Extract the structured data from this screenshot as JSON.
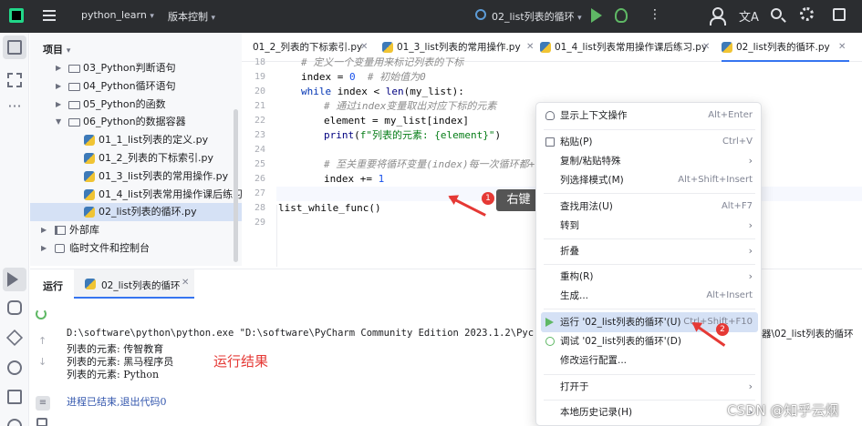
{
  "topbar": {
    "project_name": "python_learn",
    "vcs_label": "版本控制",
    "run_config": "02_list列表的循环"
  },
  "project_panel": {
    "title": "项目",
    "tree": [
      {
        "label": "03_Python判断语句",
        "type": "folder",
        "expanded": false
      },
      {
        "label": "04_Python循环语句",
        "type": "folder",
        "expanded": false
      },
      {
        "label": "05_Python的函数",
        "type": "folder",
        "expanded": false
      },
      {
        "label": "06_Python的数据容器",
        "type": "folder",
        "expanded": true
      },
      {
        "label": "01_1_list列表的定义.py",
        "type": "py"
      },
      {
        "label": "01_2_列表的下标索引.py",
        "type": "py"
      },
      {
        "label": "01_3_list列表的常用操作.py",
        "type": "py"
      },
      {
        "label": "01_4_list列表常用操作课后练习.py",
        "type": "py"
      },
      {
        "label": "02_list列表的循环.py",
        "type": "py",
        "selected": true
      },
      {
        "label": "外部库",
        "type": "lib"
      },
      {
        "label": "临时文件和控制台",
        "type": "scratch"
      }
    ]
  },
  "tabs": [
    {
      "label": "01_2_列表的下标索引.py"
    },
    {
      "label": "01_3_list列表的常用操作.py"
    },
    {
      "label": "01_4_list列表常用操作课后练习.py"
    },
    {
      "label": "02_list列表的循环.py",
      "active": true
    }
  ],
  "editor": {
    "line_numbers": [
      "18",
      "19",
      "20",
      "21",
      "22",
      "23",
      "24",
      "25",
      "26",
      "27",
      "28",
      "29"
    ],
    "l18": "# 定义一个变量用来标记列表的下标",
    "l19a": "index = ",
    "l19b": "0",
    "l19c": "  # 初始值为0",
    "l20a": "while",
    "l20b": " index < ",
    "l20c": "len",
    "l20d": "(my_list):",
    "l21": "# 通过index变量取出对应下标的元素",
    "l22": "element = my_list[index]",
    "l23a": "print",
    "l23b": "(",
    "l23c": "f\"列表的元素: {element}\"",
    "l23d": ")",
    "l25": "# 至关重要将循环变量(index)每一次循环都+1",
    "l26a": "index += ",
    "l26b": "1",
    "l29": "list_while_func()"
  },
  "annotations": {
    "badge1": "1",
    "badge2": "2",
    "right_click_label": "右键",
    "result_note": "运行结果"
  },
  "run_panel": {
    "title": "运行",
    "tab_label": "02_list列表的循环",
    "command": "D:\\software\\python\\python.exe \"D:\\software\\PyCharm Community Edition 2023.1.2\\Pyc",
    "command_tail": "器\\02_list列表的循环",
    "outputs": [
      "列表的元素: 传智教育",
      "列表的元素: 黑马程序员",
      "列表的元素: Python"
    ],
    "exit_message": "进程已结束,退出代码0"
  },
  "context_menu": {
    "items": [
      {
        "label": "显示上下文操作",
        "shortcut": "Alt+Enter",
        "icon": "bulb-icon"
      },
      {
        "label": "粘贴(P)",
        "shortcut": "Ctrl+V",
        "icon": "paste-icon"
      },
      {
        "label": "复制/粘贴特殊",
        "submenu": true
      },
      {
        "label": "列选择模式(M)",
        "shortcut": "Alt+Shift+Insert"
      },
      {
        "label": "查找用法(U)",
        "shortcut": "Alt+F7"
      },
      {
        "label": "转到",
        "submenu": true
      },
      {
        "label": "折叠",
        "submenu": true
      },
      {
        "label": "重构(R)",
        "submenu": true
      },
      {
        "label": "生成...",
        "shortcut": "Alt+Insert"
      },
      {
        "label": "运行 '02_list列表的循环'(U)",
        "shortcut": "Ctrl+Shift+F10",
        "icon": "play-icon",
        "highlighted": true
      },
      {
        "label": "调试 '02_list列表的循环'(D)",
        "icon": "bug-icon"
      },
      {
        "label": "修改运行配置..."
      },
      {
        "label": "打开于",
        "submenu": true
      },
      {
        "label": "本地历史记录(H)",
        "submenu": true
      }
    ]
  },
  "watermark": "CSDN @知乎云烟",
  "colors": {
    "accent": "#3574f0",
    "annotation_red": "#e53935",
    "run_green": "#5fb865"
  }
}
